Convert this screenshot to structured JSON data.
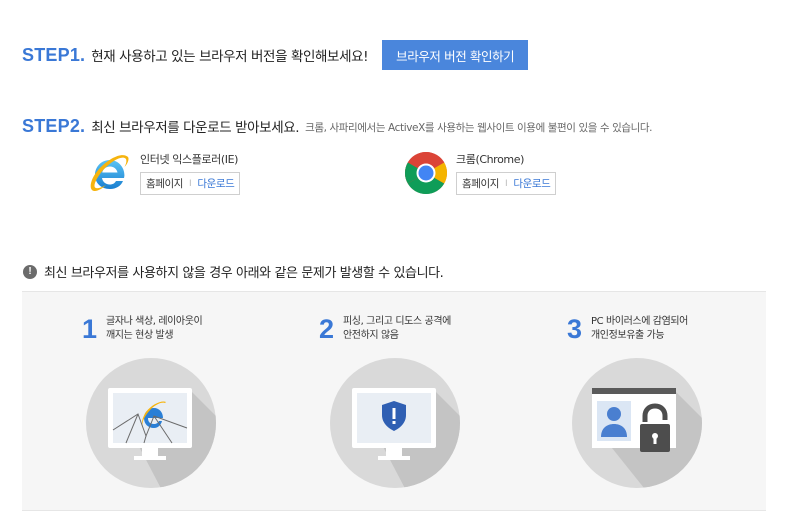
{
  "step1": {
    "label": "STEP1.",
    "text": "현재 사용하고 있는 브라우저 버전을 확인해보세요!",
    "button": "브라우저 버전 확인하기"
  },
  "step2": {
    "label": "STEP2.",
    "text": "최신 브라우저를 다운로드 받아보세요.",
    "note": "크롬, 사파리에서는 ActiveX를 사용하는 웹사이트 이용에 불편이 있을 수 있습니다."
  },
  "browsers": [
    {
      "name": "인터넷 익스플로러(IE)",
      "home": "홈페이지",
      "separator": "I",
      "download": "다운로드",
      "icon": "internet-explorer-logo"
    },
    {
      "name": "크롬(Chrome)",
      "home": "홈페이지",
      "separator": "I",
      "download": "다운로드",
      "icon": "chrome-logo"
    }
  ],
  "warning": {
    "icon_text": "!",
    "text": "최신 브라우저를 사용하지 않을 경우 아래와 같은 문제가 발생할 수 있습니다."
  },
  "issues": [
    {
      "number": "1",
      "lines": [
        "글자나 색상, 레이아웃이",
        "깨지는 현상 발생"
      ],
      "icon": "broken-monitor-icon"
    },
    {
      "number": "2",
      "lines": [
        "피싱, 그리고 디도스 공격에",
        "안전하지 않음"
      ],
      "icon": "security-shield-monitor-icon"
    },
    {
      "number": "3",
      "lines": [
        "PC 바이러스에 감염되어",
        "개인정보유출 가능"
      ],
      "icon": "unlocked-id-card-icon"
    }
  ],
  "colors": {
    "accent": "#3a78d6",
    "button": "#4a86dc",
    "panel": "#f6f6f6",
    "circle": "#d9d9d9"
  }
}
